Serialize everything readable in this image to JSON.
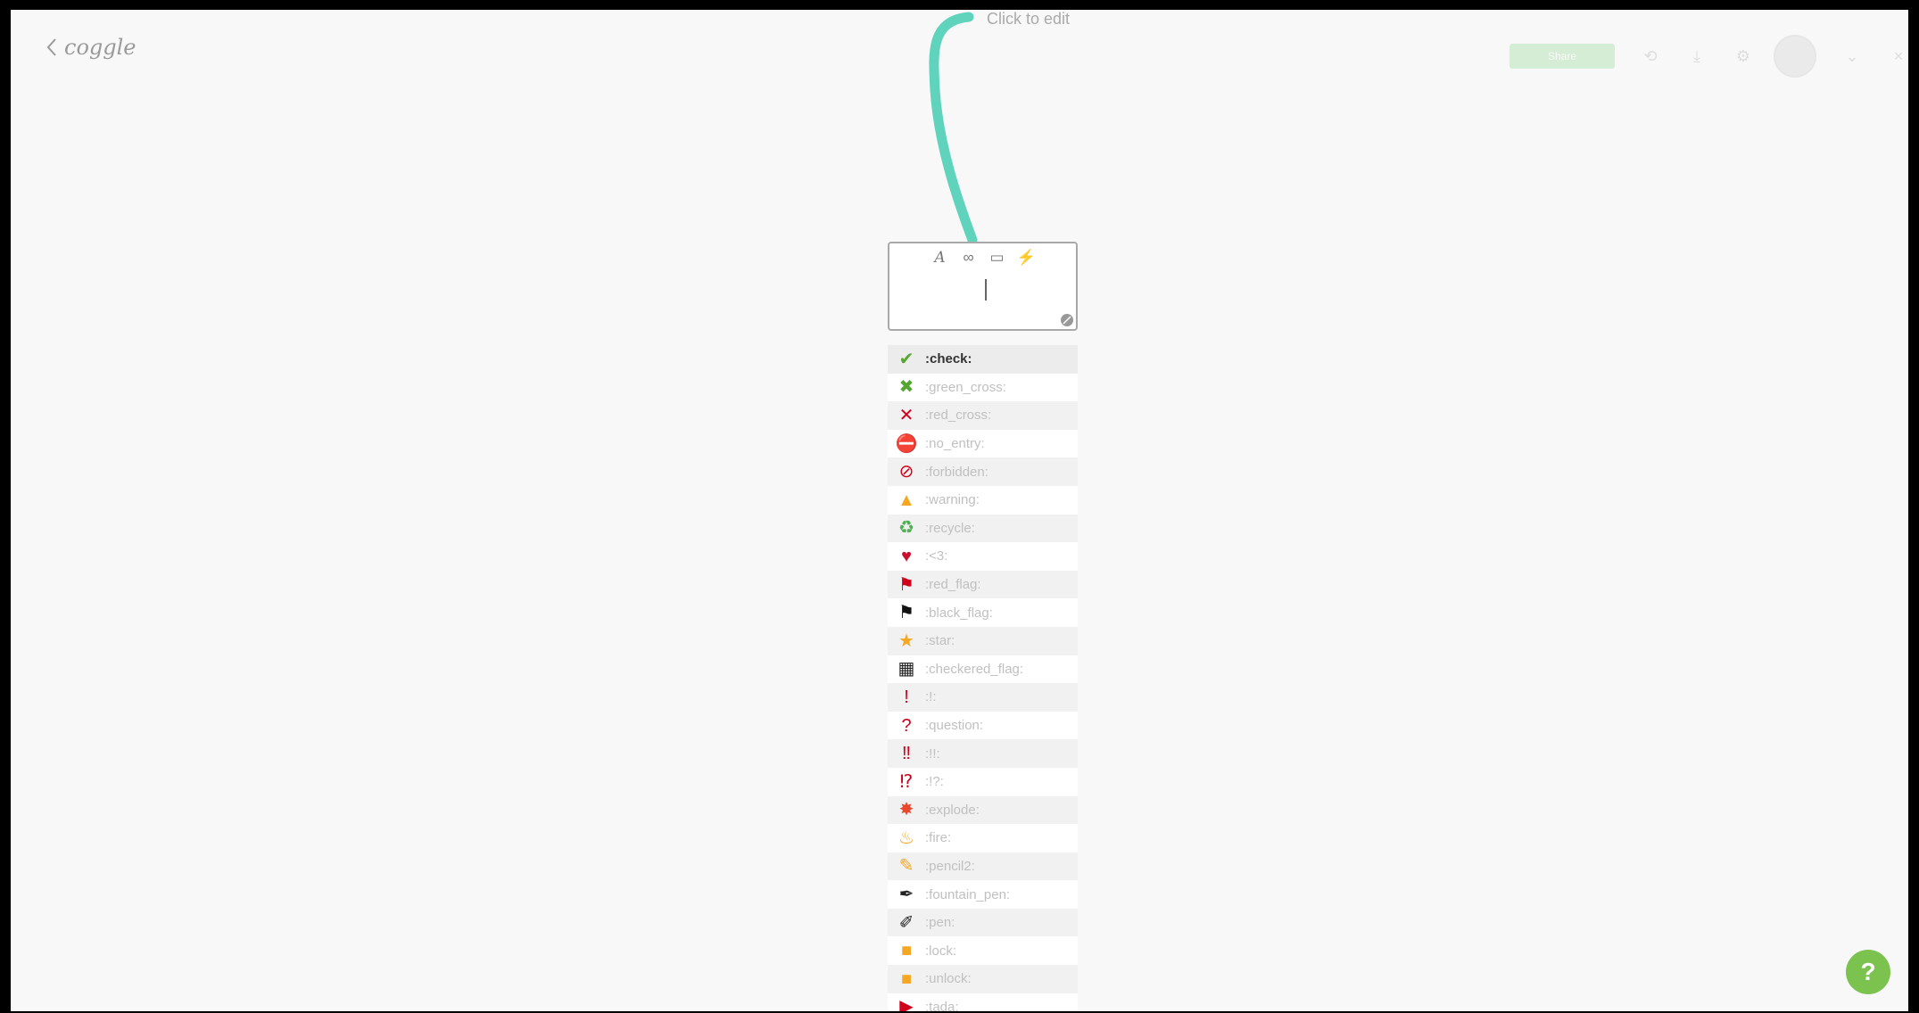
{
  "header": {
    "logo_text": "coggle"
  },
  "toolbar": {
    "share_label": "Share",
    "icons": [
      "history-icon",
      "download-icon",
      "settings-icon",
      "avatar",
      "expand-icon",
      "close-icon"
    ]
  },
  "node": {
    "label": "Click to edit"
  },
  "editor": {
    "tools": [
      "text-format-icon",
      "link-icon",
      "image-icon",
      "lightning-icon"
    ]
  },
  "emoji_list": [
    {
      "code": ":check:",
      "icon": "check-icon",
      "color": "#55a630",
      "glyph": "✔",
      "selected": true
    },
    {
      "code": ":green_cross:",
      "icon": "green-cross-icon",
      "color": "#55a630",
      "glyph": "✖"
    },
    {
      "code": ":red_cross:",
      "icon": "red-cross-icon",
      "color": "#d0021b",
      "glyph": "✕"
    },
    {
      "code": ":no_entry:",
      "icon": "no-entry-icon",
      "color": "#d0021b",
      "glyph": "⛔"
    },
    {
      "code": ":forbidden:",
      "icon": "forbidden-icon",
      "color": "#d0021b",
      "glyph": "⊘"
    },
    {
      "code": ":warning:",
      "icon": "warning-icon",
      "color": "#f5a623",
      "glyph": "▲"
    },
    {
      "code": ":recycle:",
      "icon": "recycle-icon",
      "color": "#4caf50",
      "glyph": "♻"
    },
    {
      "code": ":<3:",
      "icon": "heart-icon",
      "color": "#c8102e",
      "glyph": "♥"
    },
    {
      "code": ":red_flag:",
      "icon": "red-flag-icon",
      "color": "#d0021b",
      "glyph": "⚑"
    },
    {
      "code": ":black_flag:",
      "icon": "black-flag-icon",
      "color": "#111111",
      "glyph": "⚑"
    },
    {
      "code": ":star:",
      "icon": "star-icon",
      "color": "#f5a623",
      "glyph": "★"
    },
    {
      "code": ":checkered_flag:",
      "icon": "checkered-flag-icon",
      "color": "#222222",
      "glyph": "▦"
    },
    {
      "code": ":!:",
      "icon": "exclamation-icon",
      "color": "#d0021b",
      "glyph": "!"
    },
    {
      "code": ":question:",
      "icon": "question-icon",
      "color": "#d0021b",
      "glyph": "?"
    },
    {
      "code": ":!!:",
      "icon": "double-exclamation-icon",
      "color": "#d0021b",
      "glyph": "‼"
    },
    {
      "code": ":!?:",
      "icon": "interrobang-icon",
      "color": "#d0021b",
      "glyph": "⁉"
    },
    {
      "code": ":explode:",
      "icon": "explode-icon",
      "color": "#e8492c",
      "glyph": "✸"
    },
    {
      "code": ":fire:",
      "icon": "fire-icon",
      "color": "#f5a623",
      "glyph": "♨"
    },
    {
      "code": ":pencil2:",
      "icon": "pencil-icon",
      "color": "#f5a623",
      "glyph": "✎"
    },
    {
      "code": ":fountain_pen:",
      "icon": "fountain-pen-icon",
      "color": "#222222",
      "glyph": "✒"
    },
    {
      "code": ":pen:",
      "icon": "pen-icon",
      "color": "#222222",
      "glyph": "✐"
    },
    {
      "code": ":lock:",
      "icon": "lock-icon",
      "color": "#f5a623",
      "glyph": "■"
    },
    {
      "code": ":unlock:",
      "icon": "unlock-icon",
      "color": "#f5a623",
      "glyph": "■"
    },
    {
      "code": ":tada:",
      "icon": "tada-icon",
      "color": "#d0021b",
      "glyph": "▶"
    }
  ],
  "help": {
    "label": "?"
  },
  "colors": {
    "branch": "#5fd3bc",
    "help": "#7cc24f",
    "share": "#7ccf7c"
  }
}
